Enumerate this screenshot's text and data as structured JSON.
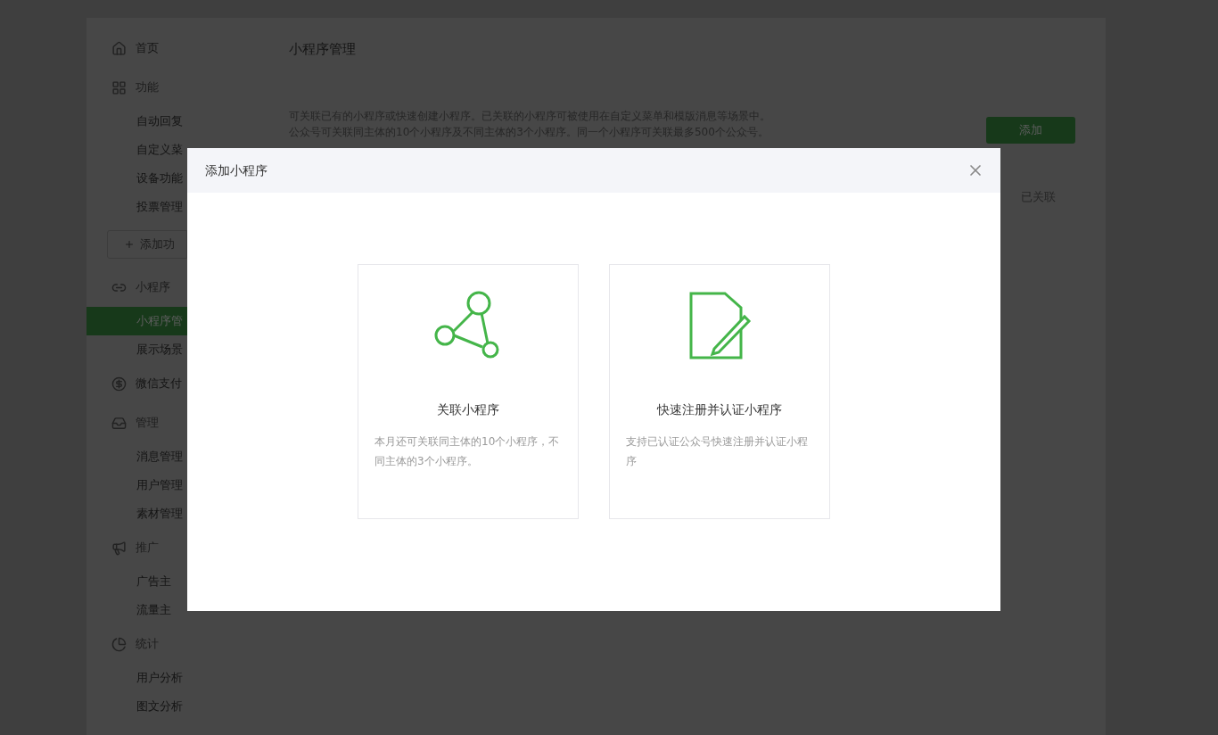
{
  "sidebar": {
    "sections": [
      {
        "title": "首页"
      },
      {
        "title": "功能",
        "items": [
          {
            "label": "自动回复",
            "selected": false
          },
          {
            "label": "自定义菜",
            "selected": false
          },
          {
            "label": "设备功能",
            "selected": false
          },
          {
            "label": "投票管理",
            "selected": false
          }
        ],
        "add_button": "添加功"
      },
      {
        "title": "小程序",
        "items": [
          {
            "label": "小程序管",
            "selected": true
          },
          {
            "label": "展示场景",
            "selected": false
          }
        ]
      },
      {
        "title": "微信支付"
      },
      {
        "title": "管理",
        "items": [
          {
            "label": "消息管理",
            "selected": false
          },
          {
            "label": "用户管理",
            "selected": false
          },
          {
            "label": "素材管理",
            "selected": false
          }
        ]
      },
      {
        "title": "推广",
        "items": [
          {
            "label": "广告主",
            "selected": false
          },
          {
            "label": "流量主",
            "selected": false
          }
        ]
      },
      {
        "title": "统计",
        "items": [
          {
            "label": "用户分析",
            "selected": false
          },
          {
            "label": "图文分析",
            "selected": false
          }
        ]
      }
    ]
  },
  "main": {
    "title": "小程序管理",
    "description": [
      "可关联已有的小程序或快速创建小程序。已关联的小程序可被使用在自定义菜单和模版消息等场景中。",
      "公众号可关联同主体的10个小程序及不同主体的3个小程序。同一个小程序可关联最多500个公众号。"
    ],
    "add_button": "添加",
    "status": "已关联"
  },
  "dialog": {
    "title": "添加小程序",
    "options": [
      {
        "kind": "link",
        "title": "关联小程序",
        "description": "本月还可关联同主体的10个小程序，不同主体的3个小程序。"
      },
      {
        "kind": "register",
        "title": "快速注册并认证小程序",
        "description": "支持已认证公众号快速注册并认证小程序"
      }
    ]
  }
}
